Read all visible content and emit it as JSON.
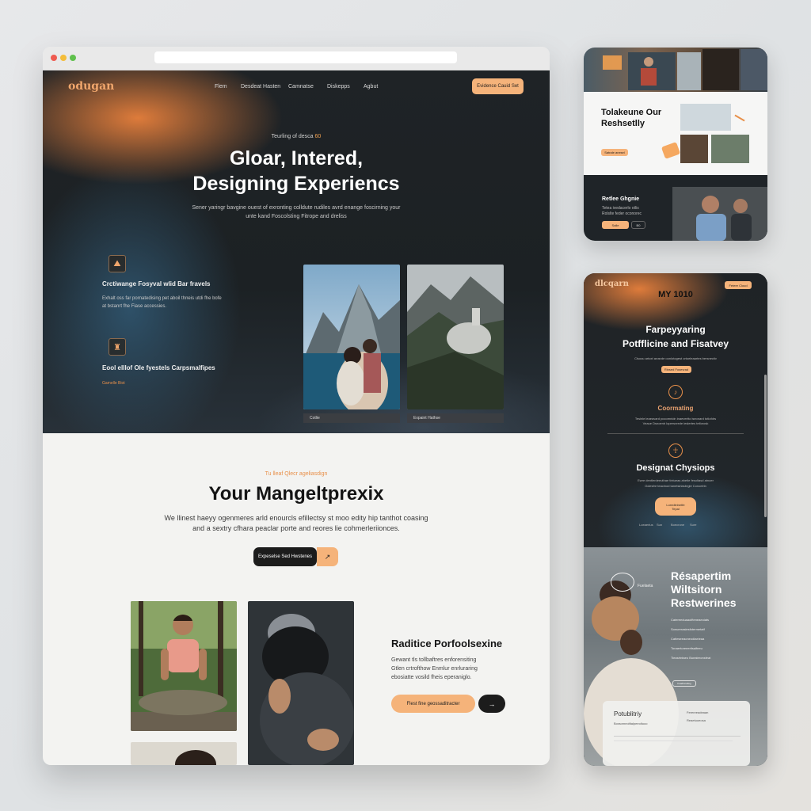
{
  "browser": {
    "hero": {
      "logo": "odugan",
      "nav": [
        "Flem",
        "Desdeat Hasten",
        "Camnatse",
        "Diskepps",
        "Agbut"
      ],
      "cta": "Evidence Cauid Set",
      "eyebrow_text": "Teurling of desca ",
      "eyebrow_accent": "60",
      "title_line1": "Gloar, Intered,",
      "title_line2": "Designing Experiencs",
      "subtitle_line1": "Sener yaringr bavgine ouest of exronting colldute rudiles avrd enange foscirning your",
      "subtitle_line2": "unte kand Foscolsting Fitrope and dreliss",
      "feature1_title": "Crctiwange Fosyval wlid Bar fravels",
      "feature1_text_line1": "Exhalt oss far pornatedising pet aboil thneis utdi fhe bofe",
      "feature1_text_line2": "at bstanrt fhe Fiase accessies.",
      "feature2_title": "Eool elllof Ole fyestels Carpsmalfipes",
      "feature2_link": "Gamelle Biot",
      "photo1_caption": "Cotlie",
      "photo2_caption": "Expaint Hathse"
    },
    "section": {
      "eyebrow": "Tu lleaf Qlecr ageliasdign",
      "title": "Your Mangeltprexix",
      "body_line1": "We llinest haeyy ogenmeres arld enourcls efillectsy st moo edity hip tanthot coasing",
      "body_line2": "and a sextry cfhara peaclar porte and reores lie cohmerleriionces.",
      "btn_dark": "Expeselse Sed Hwstenes",
      "btn_arrow": "↗",
      "feature_title": "Raditice Porfoolsexine",
      "feature_text_line1": "Gewant tls tollbaftres enforensiting",
      "feature_text_line2": "Gtlen crtrofthow Enmlur enrluraring",
      "feature_text_line3": "ebosiatte vosild fheis eperaniglo.",
      "cta_orange": "Flest fine geossaditracter",
      "cta_arrow": "→"
    }
  },
  "right_top": {
    "title_line1": "Tolakeune Our",
    "title_line2": "Reshsetlly",
    "btn": "Satrale anesel",
    "dark_title": "Retlee Ghgnie",
    "dark_text_line1": "Tetea ivedacerlo otlis",
    "dark_text_line2": "Rolslte feder oconorec",
    "btn2": "Salle",
    "btn2b": "B0"
  },
  "right_big": {
    "logo": "dlcqarn",
    "cta": "Fetere Cloud",
    "eyebrow": "MY 1010",
    "title_line1": "Farpeyyaring",
    "title_line2": "Potfflicine and Fisatvey",
    "subtitle": "Clsoou artoxt arosrde oonlotogest ortoeleaartes bersnectiv",
    "btn1": "Rinsed Fosevrad",
    "item1_icon": "♪",
    "item1_title": "Coormating",
    "item1_text_line1": "Tesinle leaeavard pocomnidn inaevertto iseonard totlofdrs",
    "item1_text_line2": "Veaue Dsnoenb lopersvrede ieslertes tetlorosk",
    "item2_icon": "☥",
    "item2_title": "Designat Chysiops",
    "item2_text_line1": "Ewre dentlerdeeuthae tintueas ahetle fesoltasd atnoer",
    "item2_text_line2": "Oolesfre teacinod tanetsirlasbrgie Conoelrin",
    "btn2_line1": "Loredleinetfe",
    "btn2_line2": "Tepal",
    "footer_links": [
      "Loeaerlus",
      "Sun",
      "Boecrone",
      "Sure"
    ],
    "s3_badge": "Fuelaeta",
    "s3_title_line1": "Résapertim",
    "s3_title_line2": "Wiltsitorn",
    "s3_title_line3": "Restwerines",
    "s3_list": [
      "Catereeduaaolfteneaeoiats",
      "Sonurerasiesfotermetatf",
      "Catteseeaoneodiaeieaa",
      "Tonaertoreeeritsaifeeu",
      "Tieasrtntaeo Bueateronsfeat"
    ],
    "s3_btn": "Feadrsnelleg",
    "card_title": "Potublitriy",
    "card_text": "Boraorneolttalpeeoltuoo",
    "card_sub_line1": "Ferenreadeaan",
    "card_sub_line2": "Reaetuoeosa"
  }
}
